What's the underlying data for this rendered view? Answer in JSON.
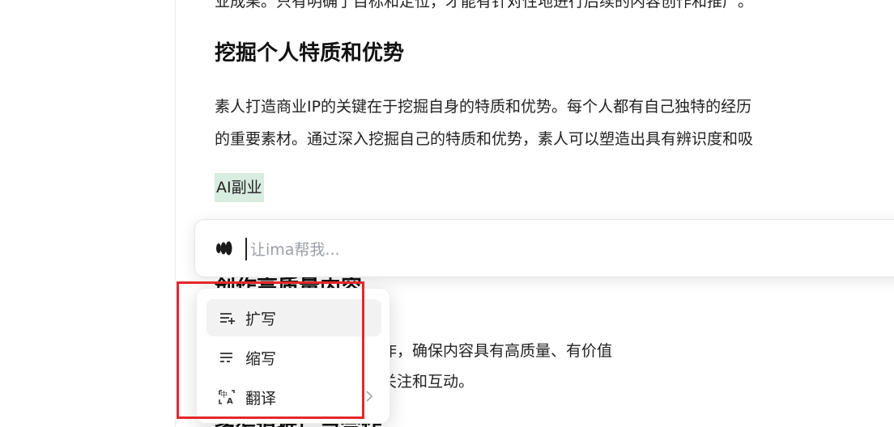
{
  "doc": {
    "top_partial_line": "业成果。只有明确了目标和定位，才能有针对性地进行后续的内容创作和推广。",
    "heading": "挖掘个人特质和优势",
    "paragraph_line1": "素人打造商业IP的关键在于挖掘自身的特质和优势。每个人都有自己独特的经历",
    "paragraph_line2": "的重要素材。通过深入挖掘自己的特质和优势，素人可以塑造出具有辨识度和吸",
    "selected_text": "AI副业",
    "hidden_heading": "创作高质量内容",
    "paragraph2_line1": "。素人需要注重内容的创作，确保内容具有高质量、有价值",
    "paragraph2_line2": "点相契合，以吸引更多的关注和互动。",
    "hidden_heading2": "多渠道推广与合作"
  },
  "ai_bar": {
    "placeholder": "让ima帮我..."
  },
  "menu": {
    "items": [
      {
        "label": "扩写",
        "icon": "expand-text-icon"
      },
      {
        "label": "缩写",
        "icon": "shorten-text-icon"
      },
      {
        "label": "翻译",
        "icon": "translate-icon"
      }
    ]
  },
  "colors": {
    "highlight": "#d8ece0",
    "annotation": "#e4272a",
    "menu_hover": "#f2f2f2"
  }
}
